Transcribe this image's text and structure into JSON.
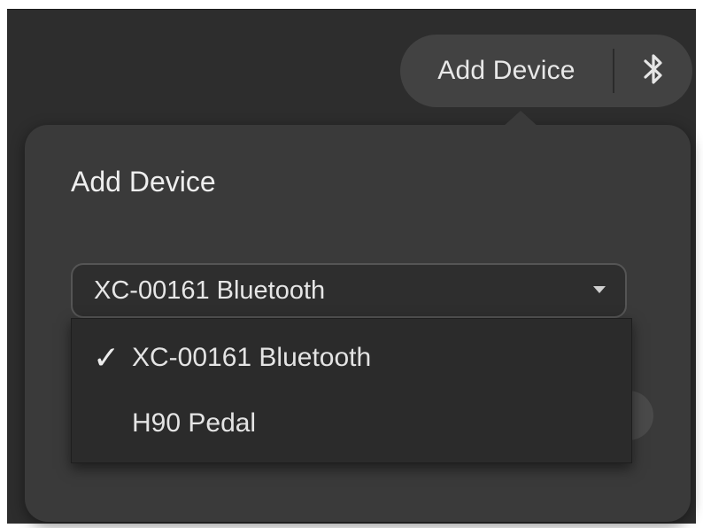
{
  "toolbar": {
    "add_device_label": "Add Device",
    "bluetooth_icon": "bluetooth-icon"
  },
  "popover": {
    "title": "Add Device",
    "select": {
      "selected_value": "XC-00161 Bluetooth"
    },
    "menu": {
      "items": [
        {
          "label": "XC-00161 Bluetooth",
          "checked": true,
          "check_glyph": "✓"
        },
        {
          "label": "H90 Pedal",
          "checked": false
        }
      ]
    }
  },
  "colors": {
    "background": "#2d2d2d",
    "popover": "#3a3a3a",
    "pill": "#424242",
    "text": "#e8e8e8"
  }
}
